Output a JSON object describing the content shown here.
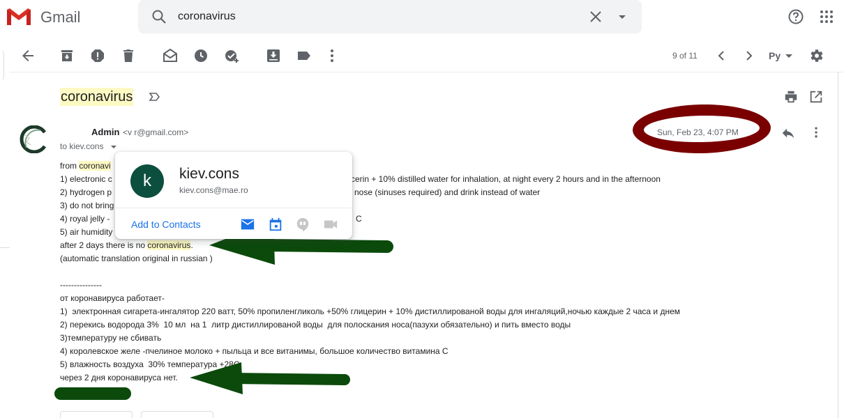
{
  "app": {
    "brand": "Gmail"
  },
  "search": {
    "query": "coronavirus"
  },
  "toolbar": {
    "pager": "9 of 11",
    "lang": "Pу"
  },
  "subject": "coronavirus",
  "message": {
    "sender_name": "Admin",
    "sender_email": "<v                      r@gmail.com>",
    "recipient": "to kiev.cons",
    "date": "Sun, Feb 23, 4:07 PM"
  },
  "body": {
    "line1_pre": "from ",
    "line1_hl": "coronavi",
    "line2_a": "1) electronic c",
    "line2_b": "cerin + 10% distilled water for inhalation, at night every 2 hours and in the afternoon",
    "line3_a": "2) hydrogen p",
    "line3_b": "nose (sinuses required) and drink instead of water",
    "line4": "3) do not bring",
    "line5_a": "4) royal jelly -",
    "line5_b": "C",
    "line6": "5) air humidity",
    "line7_pre": "after 2 days there is no ",
    "line7_hl": "coronavirus",
    "line7_post": ".",
    "line8": "(automatic translation original in russian )",
    "line10": "---------------",
    "ru1": "от коронавируса работает-",
    "ru2": "1)  электронная сигарета-ингалятор 220 ватт, 50% пропиленгликоль +50% глицерин + 10% дистиллированой воды для ингаляций,ночью каждые 2 часа и днем",
    "ru3": "2) перекись водорода 3%  10 мл  на 1  литр дистиллированой воды  для полоскания носа(пазухи обязательно) и пить вместо воды",
    "ru4": "3)температуру не сбивать",
    "ru5": "4) королевское желе -пчелиное молоко + пыльца и все витанимы, большое количество витамина С",
    "ru6": "5) влажность воздуха  30% температура +28С",
    "ru7": "через 2 дня коронавируса нет."
  },
  "contact_card": {
    "initial": "k",
    "name": "kiev.cons",
    "email": "kiev.cons@mae.ro",
    "add_label": "Add to Contacts"
  },
  "colors": {
    "highlight": "#fdf9c2",
    "arrow": "#0b4a0b",
    "oval": "#7a0000",
    "link": "#1a73e8"
  }
}
